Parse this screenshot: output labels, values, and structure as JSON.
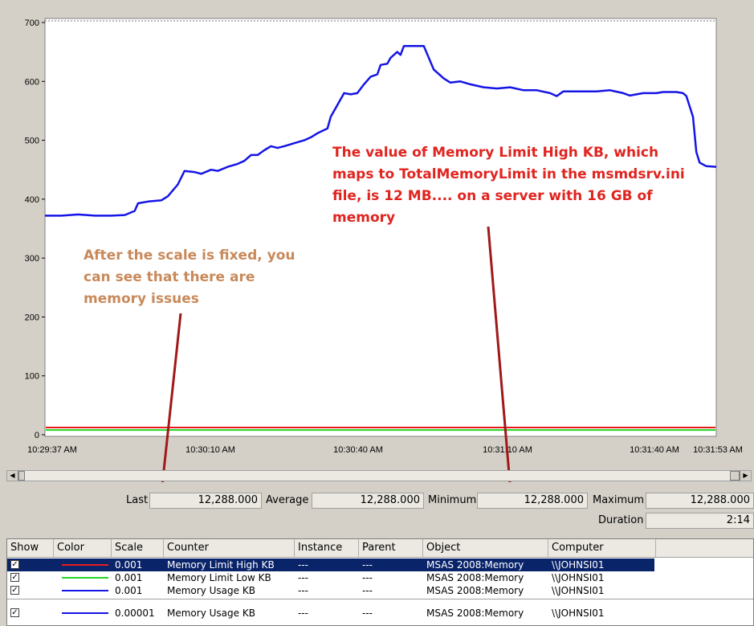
{
  "chart_data": {
    "type": "line",
    "ylim": [
      0,
      700
    ],
    "yticks": [
      0,
      100,
      200,
      300,
      400,
      500,
      600,
      700
    ],
    "x_tick_labels": [
      "10:29:37 AM",
      "10:30:10 AM",
      "10:30:40 AM",
      "10:31:10 AM",
      "10:31:40 AM",
      "10:31:53 AM"
    ],
    "xlim_seconds": [
      0,
      136
    ],
    "series": [
      {
        "color": "#1414e6",
        "points": [
          [
            0,
            372
          ],
          [
            5,
            372
          ],
          [
            10,
            374
          ],
          [
            15,
            372
          ],
          [
            20,
            372
          ],
          [
            24,
            373
          ],
          [
            27,
            380
          ],
          [
            28,
            393
          ],
          [
            31,
            396
          ],
          [
            35,
            398
          ],
          [
            37,
            405
          ],
          [
            40,
            425
          ],
          [
            42,
            448
          ],
          [
            45,
            446
          ],
          [
            47,
            443
          ],
          [
            50,
            450
          ],
          [
            52,
            448
          ],
          [
            55,
            455
          ],
          [
            58,
            460
          ],
          [
            60,
            465
          ],
          [
            62,
            475
          ],
          [
            64,
            475
          ],
          [
            66,
            483
          ],
          [
            68,
            490
          ],
          [
            70,
            487
          ],
          [
            72,
            490
          ],
          [
            75,
            495
          ],
          [
            78,
            500
          ],
          [
            80,
            505
          ],
          [
            82,
            512
          ],
          [
            85,
            520
          ],
          [
            86,
            540
          ],
          [
            88,
            560
          ],
          [
            90,
            580
          ],
          [
            92,
            578
          ],
          [
            94,
            580
          ],
          [
            96,
            595
          ],
          [
            98,
            608
          ],
          [
            100,
            612
          ],
          [
            101,
            628
          ],
          [
            103,
            630
          ],
          [
            104,
            640
          ],
          [
            106,
            650
          ],
          [
            107,
            645
          ],
          [
            108,
            660
          ],
          [
            111,
            660
          ],
          [
            114,
            660
          ],
          [
            117,
            620
          ],
          [
            120,
            605
          ],
          [
            122,
            598
          ],
          [
            125,
            600
          ],
          [
            128,
            595
          ],
          [
            132,
            590
          ],
          [
            136,
            588
          ],
          [
            140,
            590
          ],
          [
            144,
            585
          ],
          [
            148,
            585
          ],
          [
            152,
            580
          ],
          [
            154,
            575
          ],
          [
            156,
            583
          ],
          [
            160,
            583
          ],
          [
            166,
            583
          ],
          [
            170,
            585
          ],
          [
            174,
            580
          ],
          [
            176,
            576
          ],
          [
            180,
            580
          ],
          [
            184,
            580
          ],
          [
            186,
            582
          ],
          [
            190,
            582
          ],
          [
            192,
            580
          ],
          [
            193,
            575
          ],
          [
            195,
            540
          ],
          [
            196,
            480
          ],
          [
            197,
            462
          ],
          [
            199,
            456
          ],
          [
            202,
            455
          ]
        ]
      },
      {
        "color": "#e81b1b",
        "constant": 12.3
      },
      {
        "color": "#21d421",
        "constant": 8
      }
    ]
  },
  "annotations": {
    "red_lines": [
      "The value of Memory Limit High KB, which",
      "maps to TotalMemoryLimit in the msmdsrv.ini",
      "file, is 12 MB.... on a server with 16 GB of",
      "memory"
    ],
    "tan_lines": [
      "After the scale is fixed, you",
      "can see that there are",
      "memory issues"
    ]
  },
  "stats": {
    "last_label": "Last",
    "last_value": "12,288.000",
    "average_label": "Average",
    "average_value": "12,288.000",
    "minimum_label": "Minimum",
    "minimum_value": "12,288.000",
    "maximum_label": "Maximum",
    "maximum_value": "12,288.000",
    "duration_label": "Duration",
    "duration_value": "2:14"
  },
  "table": {
    "headers": [
      "Show",
      "Color",
      "Scale",
      "Counter",
      "Instance",
      "Parent",
      "Object",
      "Computer"
    ],
    "rows": [
      {
        "checked": "✓",
        "color": "#e81b1b",
        "scale": "0.001",
        "counter": "Memory Limit High KB",
        "instance": "---",
        "parent": "---",
        "object": "MSAS 2008:Memory",
        "computer": "\\\\JOHNSI01"
      },
      {
        "checked": "✓",
        "color": "#21d421",
        "scale": "0.001",
        "counter": "Memory Limit Low KB",
        "instance": "---",
        "parent": "---",
        "object": "MSAS 2008:Memory",
        "computer": "\\\\JOHNSI01"
      },
      {
        "checked": "✓",
        "color": "#1414e6",
        "scale": "0.001",
        "counter": "Memory Usage KB",
        "instance": "---",
        "parent": "---",
        "object": "MSAS 2008:Memory",
        "computer": "\\\\JOHNSI01"
      },
      {
        "checked": "✓",
        "color": "#1414e6",
        "scale": "0.00001",
        "counter": "Memory Usage KB",
        "instance": "---",
        "parent": "---",
        "object": "MSAS 2008:Memory",
        "computer": "\\\\JOHNSI01"
      }
    ]
  },
  "colors": {
    "arrow": "#a01818",
    "selected_row": "#0a246a"
  }
}
